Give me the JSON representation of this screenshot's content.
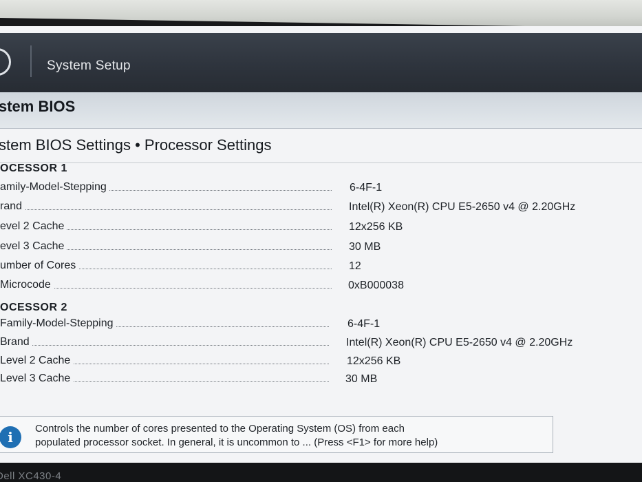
{
  "header": {
    "app_title": "System Setup"
  },
  "band": {
    "title": "stem BIOS"
  },
  "page": {
    "title": "stem BIOS Settings • Processor Settings"
  },
  "processor1": {
    "heading": "OCESSOR 1",
    "rows": [
      {
        "label": "amily-Model-Stepping",
        "value": "6-4F-1"
      },
      {
        "label": "rand",
        "value": "Intel(R) Xeon(R) CPU E5-2650 v4 @ 2.20GHz"
      },
      {
        "label": "evel 2 Cache",
        "value": "12x256 KB"
      },
      {
        "label": "evel 3 Cache",
        "value": "30 MB"
      },
      {
        "label": "umber of Cores",
        "value": "12"
      },
      {
        "label": "Microcode",
        "value": "0xB000038"
      }
    ]
  },
  "processor2": {
    "heading": "OCESSOR 2",
    "rows": [
      {
        "label": "Family-Model-Stepping",
        "value": "6-4F-1"
      },
      {
        "label": "Brand",
        "value": "Intel(R) Xeon(R) CPU E5-2650 v4 @ 2.20GHz"
      },
      {
        "label": "Level 2 Cache",
        "value": "12x256 KB"
      },
      {
        "label": "Level 3 Cache",
        "value": "30 MB"
      }
    ]
  },
  "help": {
    "icon": "info-icon",
    "line1": "Controls the number of cores presented to the Operating System (OS) from each",
    "line2": "populated processor socket. In general, it is uncommon to ... (Press <F1> for more help)"
  },
  "device": {
    "model": "Dell XC430-4"
  }
}
